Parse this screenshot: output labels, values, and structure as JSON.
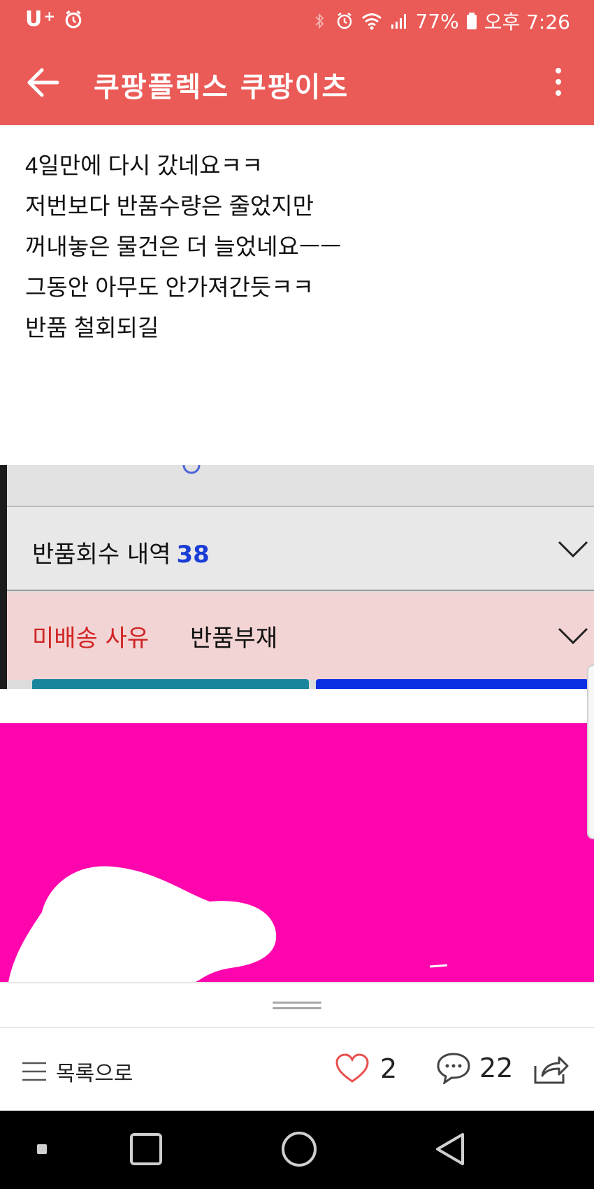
{
  "status_bar": {
    "carrier": "U",
    "carrier_sup": "+",
    "battery": "77%",
    "time": "오후 7:26",
    "icons": [
      "alarm-icon",
      "bluetooth-icon",
      "wifi-icon",
      "signal-icon",
      "battery-icon"
    ]
  },
  "app_bar": {
    "title": "쿠팡플렉스 쿠팡이츠",
    "back_icon": "arrow-left-icon",
    "menu_icon": "more-vert-icon"
  },
  "post": {
    "lines": [
      "4일만에 다시 갔네요ㅋㅋ",
      "저번보다 반품수량은 줄었지만",
      "꺼내놓은 물건은 더 늘었네요ㅡㅡ",
      "그동안 아무도 안가져간듯ㅋㅋ",
      "반품 철회되길"
    ]
  },
  "photo1": {
    "return_history_label": "반품회수 내역",
    "return_history_count": "38",
    "undelivered_label": "미배송 사유",
    "undelivered_value": "반품부재"
  },
  "action_bar": {
    "list_label": "목록으로",
    "like_count": "2",
    "comment_count": "22"
  },
  "colors": {
    "brand": "#ea5a56",
    "photo2_bg": "#ff05ae",
    "highlight_blue": "#1a3dd6",
    "alert_red": "#d02424"
  }
}
